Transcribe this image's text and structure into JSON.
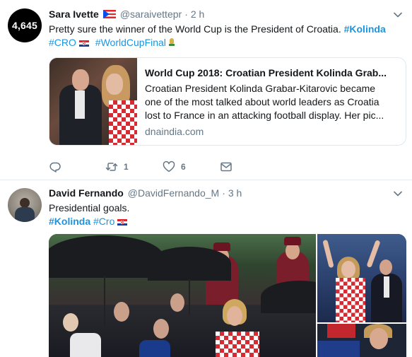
{
  "tweets": [
    {
      "avatar_text": "4,645",
      "name": "Sara Ivette",
      "handle": "@saraivettepr",
      "separator": "·",
      "time": "2 h",
      "text_line1": "Pretty sure the winner of the World Cup is the President of Croatia.",
      "hashtags_line1": [
        "#Kolinda"
      ],
      "hashtags_line2": [
        "#CRO",
        "#WorldCupFinal"
      ],
      "card": {
        "title": "World Cup 2018: Croatian President Kolinda Grab...",
        "description_lines": [
          "Croatian President Kolinda Grabar-Kitarovic became",
          "one of the most talked about world leaders as Croatia",
          "lost to France in an attacking football display. Her pic..."
        ],
        "domain": "dnaindia.com"
      },
      "actions": {
        "reply_count": "",
        "retweet_count": "1",
        "like_count": "6"
      }
    },
    {
      "name": "David Fernando",
      "handle": "@DavidFernando_M",
      "separator": "·",
      "time": "3 h",
      "text_line1": "Presidential goals.",
      "hashtags_line2": [
        "#Kolinda",
        "#Cro"
      ]
    }
  ],
  "colors": {
    "link": "#1b95e0",
    "text": "#14171a",
    "secondary": "#657786",
    "border": "#e6ecf0"
  },
  "icons": [
    "chevron-down-icon",
    "reply-icon",
    "retweet-icon",
    "like-icon",
    "direct-message-icon",
    "flag-puerto-rico-icon",
    "flag-croatia-icon",
    "trophy-icon"
  ]
}
